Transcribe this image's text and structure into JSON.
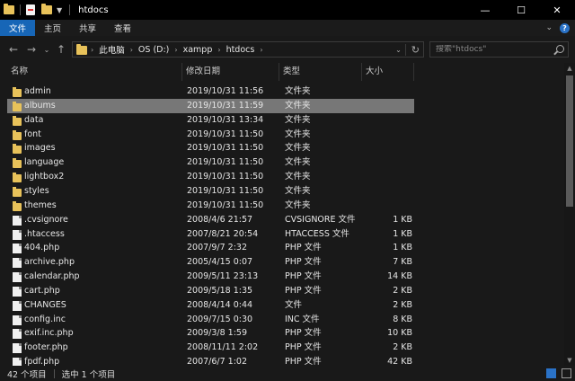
{
  "window": {
    "title": "htdocs"
  },
  "window_controls": {
    "minimize": "—",
    "maximize": "☐",
    "close": "✕"
  },
  "ribbon": {
    "tabs": [
      "文件",
      "主页",
      "共享",
      "查看"
    ],
    "active_tab": 0
  },
  "address": {
    "crumbs": [
      "此电脑",
      "OS (D:)",
      "xampp",
      "htdocs"
    ]
  },
  "search": {
    "placeholder": "搜索\"htdocs\""
  },
  "columns": {
    "name": "名称",
    "date": "修改日期",
    "type": "类型",
    "size": "大小"
  },
  "files": [
    {
      "kind": "folder",
      "name": "admin",
      "date": "2019/10/31 11:56",
      "type": "文件夹",
      "size": ""
    },
    {
      "kind": "folder",
      "name": "albums",
      "date": "2019/10/31 11:59",
      "type": "文件夹",
      "size": "",
      "selected": true
    },
    {
      "kind": "folder",
      "name": "data",
      "date": "2019/10/31 13:34",
      "type": "文件夹",
      "size": ""
    },
    {
      "kind": "folder",
      "name": "font",
      "date": "2019/10/31 11:50",
      "type": "文件夹",
      "size": ""
    },
    {
      "kind": "folder",
      "name": "images",
      "date": "2019/10/31 11:50",
      "type": "文件夹",
      "size": ""
    },
    {
      "kind": "folder",
      "name": "language",
      "date": "2019/10/31 11:50",
      "type": "文件夹",
      "size": ""
    },
    {
      "kind": "folder",
      "name": "lightbox2",
      "date": "2019/10/31 11:50",
      "type": "文件夹",
      "size": ""
    },
    {
      "kind": "folder",
      "name": "styles",
      "date": "2019/10/31 11:50",
      "type": "文件夹",
      "size": ""
    },
    {
      "kind": "folder",
      "name": "themes",
      "date": "2019/10/31 11:50",
      "type": "文件夹",
      "size": ""
    },
    {
      "kind": "file",
      "name": ".cvsignore",
      "date": "2008/4/6 21:57",
      "type": "CVSIGNORE 文件",
      "size": "1 KB"
    },
    {
      "kind": "file",
      "name": ".htaccess",
      "date": "2007/8/21 20:54",
      "type": "HTACCESS 文件",
      "size": "1 KB"
    },
    {
      "kind": "file",
      "name": "404.php",
      "date": "2007/9/7 2:32",
      "type": "PHP 文件",
      "size": "1 KB"
    },
    {
      "kind": "file",
      "name": "archive.php",
      "date": "2005/4/15 0:07",
      "type": "PHP 文件",
      "size": "7 KB"
    },
    {
      "kind": "file",
      "name": "calendar.php",
      "date": "2009/5/11 23:13",
      "type": "PHP 文件",
      "size": "14 KB"
    },
    {
      "kind": "file",
      "name": "cart.php",
      "date": "2009/5/18 1:35",
      "type": "PHP 文件",
      "size": "2 KB"
    },
    {
      "kind": "file",
      "name": "CHANGES",
      "date": "2008/4/14 0:44",
      "type": "文件",
      "size": "2 KB"
    },
    {
      "kind": "file",
      "name": "config.inc",
      "date": "2009/7/15 0:30",
      "type": "INC 文件",
      "size": "8 KB"
    },
    {
      "kind": "file",
      "name": "exif.inc.php",
      "date": "2009/3/8 1:59",
      "type": "PHP 文件",
      "size": "10 KB"
    },
    {
      "kind": "file",
      "name": "footer.php",
      "date": "2008/11/11 2:02",
      "type": "PHP 文件",
      "size": "2 KB"
    },
    {
      "kind": "file",
      "name": "fpdf.php",
      "date": "2007/6/7 1:02",
      "type": "PHP 文件",
      "size": "42 KB"
    }
  ],
  "status": {
    "count": "42 个项目",
    "selection": "选中 1 个项目"
  }
}
